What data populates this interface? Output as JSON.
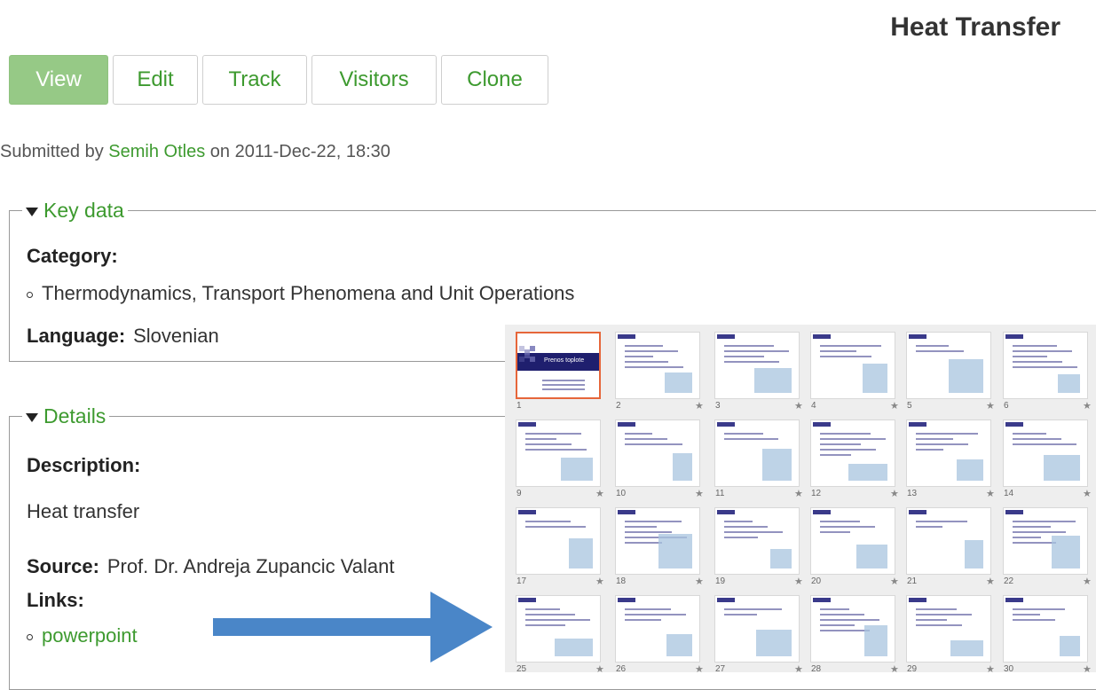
{
  "page": {
    "title": "Heat Transfer"
  },
  "tabs": [
    {
      "label": "View",
      "active": true
    },
    {
      "label": "Edit",
      "active": false
    },
    {
      "label": "Track",
      "active": false
    },
    {
      "label": "Visitors",
      "active": false
    },
    {
      "label": "Clone",
      "active": false
    }
  ],
  "submitted": {
    "prefix": "Submitted by",
    "author": "Semih Otles",
    "middle": "on",
    "date": "2011-Dec-22, 18:30"
  },
  "key_data": {
    "legend": "Key data",
    "category_label": "Category:",
    "category_value": "Thermodynamics, Transport Phenomena and Unit Operations",
    "language_label": "Language:",
    "language_value": "Slovenian"
  },
  "details": {
    "legend": "Details",
    "description_label": "Description:",
    "description_value": "Heat transfer",
    "source_label": "Source:",
    "source_value": "Prof. Dr. Andreja Zupancic Valant",
    "links_label": "Links:",
    "link_text": "powerpoint"
  },
  "slides": {
    "first_title": "Prenos toplote",
    "numbers": [
      "1",
      "2",
      "3",
      "4",
      "5",
      "6",
      "9",
      "10",
      "11",
      "12",
      "13",
      "14",
      "17",
      "18",
      "19",
      "20",
      "21",
      "22",
      "25",
      "26",
      "27",
      "28",
      "29",
      "30"
    ]
  },
  "colors": {
    "accent": "#3d9a2f",
    "active_tab": "#96c986",
    "arrow": "#4a86c8",
    "selected_slide": "#e6663a"
  }
}
